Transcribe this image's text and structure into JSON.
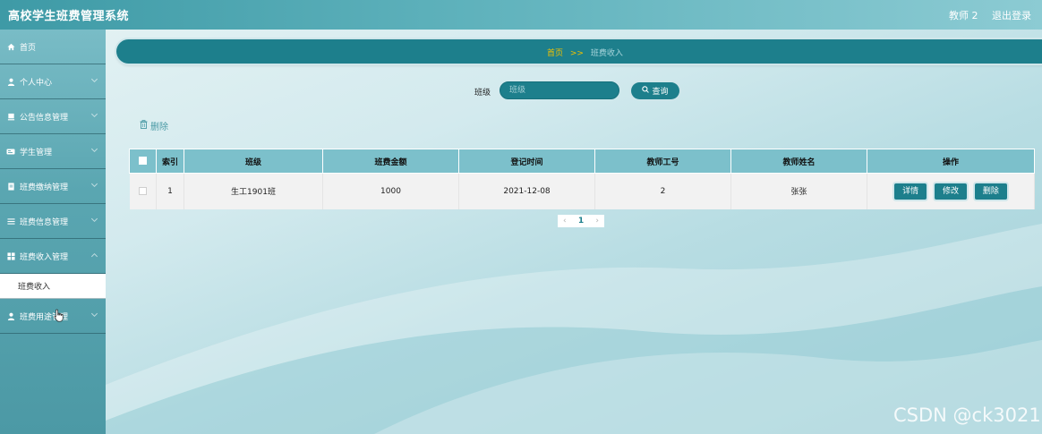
{
  "app": {
    "title": "高校学生班费管理系统"
  },
  "header": {
    "user": "教师 2",
    "logout": "退出登录"
  },
  "sidebar": {
    "items": [
      {
        "label": "首页",
        "icon": "home-icon"
      },
      {
        "label": "个人中心",
        "icon": "user-icon"
      },
      {
        "label": "公告信息管理",
        "icon": "notice-icon"
      },
      {
        "label": "学生管理",
        "icon": "id-card-icon"
      },
      {
        "label": "班费缴纳管理",
        "icon": "doc-icon"
      },
      {
        "label": "班费信息管理",
        "icon": "list-icon"
      },
      {
        "label": "班费收入管理",
        "icon": "grid-icon"
      },
      {
        "label": "班费用途管理",
        "icon": "user-icon"
      }
    ],
    "submenu": {
      "label": "班费收入"
    }
  },
  "breadcrumb": {
    "home": "首页",
    "separator": ">>",
    "current": "班费收入"
  },
  "search": {
    "label": "班级",
    "placeholder": "班级",
    "button": "查询"
  },
  "toolbar": {
    "delete": "删除"
  },
  "table": {
    "headers": {
      "index": "索引",
      "class": "班级",
      "amount": "班费金额",
      "time": "登记时间",
      "teacher_id": "教师工号",
      "teacher_name": "教师姓名",
      "actions": "操作"
    },
    "rows": [
      {
        "index": "1",
        "class": "生工1901班",
        "amount": "1000",
        "time": "2021-12-08",
        "teacher_id": "2",
        "teacher_name": "张张"
      }
    ],
    "actions": {
      "detail": "详情",
      "edit": "修改",
      "delete": "删除"
    }
  },
  "pagination": {
    "prev": "‹",
    "page": "1",
    "next": "›"
  },
  "watermark": "CSDN @ck3021",
  "colors": {
    "primary": "#1d7f8c",
    "header": "#7cc0cb",
    "accent": "#f2c200"
  }
}
